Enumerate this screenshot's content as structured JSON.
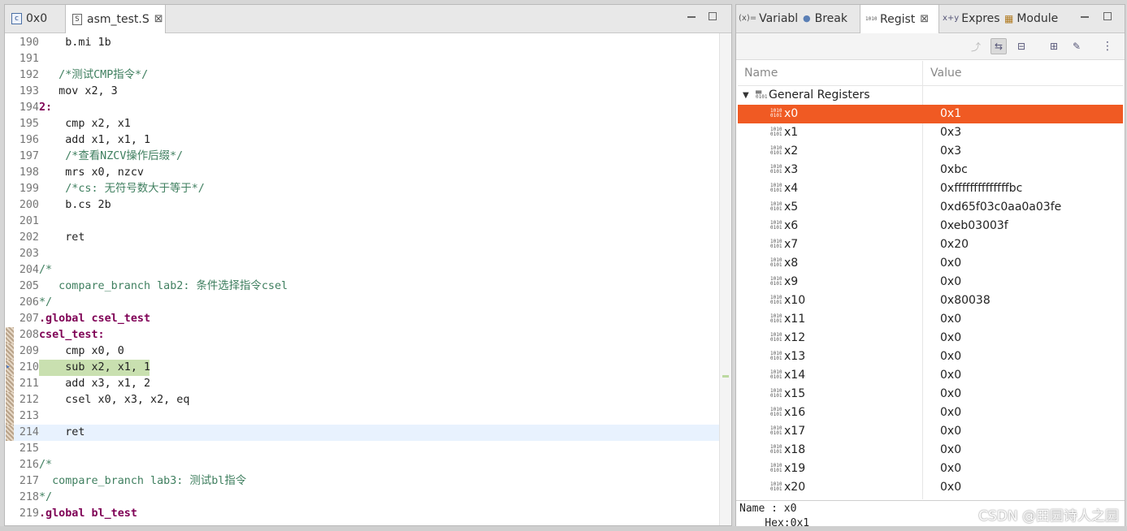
{
  "editor": {
    "tabs": [
      {
        "label": "0x0",
        "icon": "c-file-icon"
      },
      {
        "label": "asm_test.S",
        "icon": "s-file-icon",
        "close": "⊠"
      }
    ],
    "lines": [
      {
        "n": "190",
        "t": "    b.mi 1b",
        "cls": "kw"
      },
      {
        "n": "191",
        "t": "",
        "cls": "kw"
      },
      {
        "n": "192",
        "t": "   /*测试CMP指令*/",
        "cls": "cm"
      },
      {
        "n": "193",
        "t": "   mov x2, 3",
        "cls": "kw"
      },
      {
        "n": "194",
        "t": "2:",
        "cls": "lbl"
      },
      {
        "n": "195",
        "t": "    cmp x2, x1",
        "cls": "kw"
      },
      {
        "n": "196",
        "t": "    add x1, x1, 1",
        "cls": "kw"
      },
      {
        "n": "197",
        "t": "    /*查看NZCV操作后缀*/",
        "cls": "cm"
      },
      {
        "n": "198",
        "t": "    mrs x0, nzcv",
        "cls": "kw"
      },
      {
        "n": "199",
        "t": "    /*cs: 无符号数大于等于*/",
        "cls": "cm"
      },
      {
        "n": "200",
        "t": "    b.cs 2b",
        "cls": "kw"
      },
      {
        "n": "201",
        "t": "",
        "cls": "kw"
      },
      {
        "n": "202",
        "t": "    ret",
        "cls": "kw"
      },
      {
        "n": "203",
        "t": "",
        "cls": "kw"
      },
      {
        "n": "204",
        "t": "/*",
        "cls": "cm"
      },
      {
        "n": "205",
        "t": "   compare_branch lab2: 条件选择指令csel",
        "cls": "cm"
      },
      {
        "n": "206",
        "t": "*/",
        "cls": "cm"
      },
      {
        "n": "207",
        "t": ".global csel_test",
        "cls": "dir"
      },
      {
        "n": "208",
        "t": "csel_test:",
        "cls": "lbl"
      },
      {
        "n": "209",
        "t": "    cmp x0, 0",
        "cls": "kw"
      },
      {
        "n": "210",
        "t": "    sub x2, x1, 1",
        "cls": "kw"
      },
      {
        "n": "211",
        "t": "    add x3, x1, 2",
        "cls": "kw"
      },
      {
        "n": "212",
        "t": "    csel x0, x3, x2, eq",
        "cls": "kw"
      },
      {
        "n": "213",
        "t": "",
        "cls": "kw"
      },
      {
        "n": "214",
        "t": "    ret",
        "cls": "kw"
      },
      {
        "n": "215",
        "t": "",
        "cls": "kw"
      },
      {
        "n": "216",
        "t": "/*",
        "cls": "cm"
      },
      {
        "n": "217",
        "t": "  compare_branch lab3: 测试bl指令",
        "cls": "cm"
      },
      {
        "n": "218",
        "t": "*/",
        "cls": "cm"
      },
      {
        "n": "219",
        "t": ".global bl_test",
        "cls": "dir"
      }
    ]
  },
  "registers_view": {
    "tabs": [
      {
        "label": "Variabl",
        "icon": "(x)="
      },
      {
        "label": "Break",
        "icon": "●"
      },
      {
        "label": "Regist",
        "icon": "1010"
      },
      {
        "label": "Expres",
        "icon": "x+y"
      },
      {
        "label": "Module",
        "icon": "▦"
      }
    ],
    "columns": {
      "name": "Name",
      "value": "Value"
    },
    "group": "General Registers",
    "registers": [
      {
        "name": "x0",
        "value": "0x1"
      },
      {
        "name": "x1",
        "value": "0x3"
      },
      {
        "name": "x2",
        "value": "0x3"
      },
      {
        "name": "x3",
        "value": "0xbc"
      },
      {
        "name": "x4",
        "value": "0xffffffffffffffbc"
      },
      {
        "name": "x5",
        "value": "0xd65f03c0aa0a03fe"
      },
      {
        "name": "x6",
        "value": "0xeb03003f"
      },
      {
        "name": "x7",
        "value": "0x20"
      },
      {
        "name": "x8",
        "value": "0x0"
      },
      {
        "name": "x9",
        "value": "0x0"
      },
      {
        "name": "x10",
        "value": "0x80038"
      },
      {
        "name": "x11",
        "value": "0x0"
      },
      {
        "name": "x12",
        "value": "0x0"
      },
      {
        "name": "x13",
        "value": "0x0"
      },
      {
        "name": "x14",
        "value": "0x0"
      },
      {
        "name": "x15",
        "value": "0x0"
      },
      {
        "name": "x16",
        "value": "0x0"
      },
      {
        "name": "x17",
        "value": "0x0"
      },
      {
        "name": "x18",
        "value": "0x0"
      },
      {
        "name": "x19",
        "value": "0x0"
      },
      {
        "name": "x20",
        "value": "0x0"
      }
    ],
    "detail": {
      "line1": "Name : x0",
      "line2": "    Hex:0x1"
    },
    "selected_color": "#f05a23"
  },
  "watermark": "CSDN @田园诗人之园"
}
